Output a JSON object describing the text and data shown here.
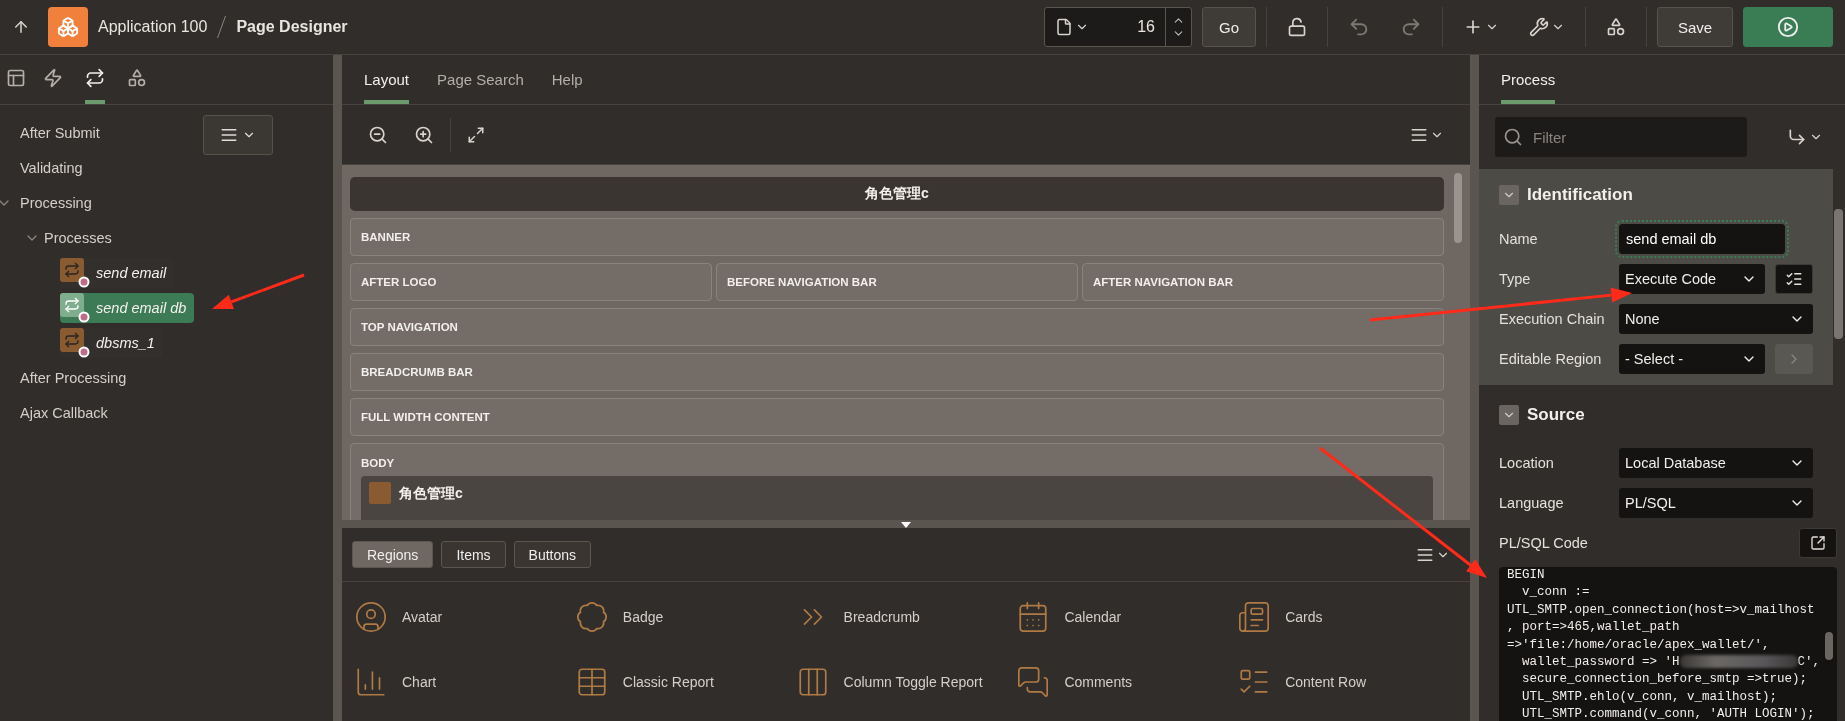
{
  "header": {
    "app": "Application 100",
    "page": "Page Designer"
  },
  "toolbar": {
    "page_number": "16",
    "go": "Go",
    "save": "Save"
  },
  "left_tabs": [
    {
      "kind": "rendering",
      "selected": false
    },
    {
      "kind": "dynamic-actions",
      "selected": false
    },
    {
      "kind": "processing",
      "selected": true
    },
    {
      "kind": "shared",
      "selected": false
    }
  ],
  "tree": [
    {
      "label": "After Submit"
    },
    {
      "label": "Validating"
    },
    {
      "label": "Processing",
      "expanded": true,
      "children": [
        {
          "label": "Processes",
          "expanded": true,
          "children": [
            {
              "label": "send email",
              "kind": "process",
              "selected": false
            },
            {
              "label": "send email db",
              "kind": "process",
              "selected": true
            },
            {
              "label": "dbsms_1",
              "kind": "process",
              "selected": false
            }
          ]
        }
      ]
    },
    {
      "label": "After Processing"
    },
    {
      "label": "Ajax Callback"
    }
  ],
  "center_tabs": [
    {
      "label": "Layout",
      "selected": true
    },
    {
      "label": "Page Search",
      "selected": false
    },
    {
      "label": "Help",
      "selected": false
    }
  ],
  "layout": {
    "page_title": "角色管理c",
    "rows": [
      [
        "BANNER"
      ],
      [
        "AFTER LOGO",
        "BEFORE NAVIGATION BAR",
        "AFTER NAVIGATION BAR"
      ],
      [
        "TOP NAVIGATION"
      ],
      [
        "BREADCRUMB BAR"
      ],
      [
        "FULL WIDTH CONTENT"
      ]
    ],
    "body": {
      "label": "BODY",
      "region": "角色管理c"
    }
  },
  "gallery": {
    "tabs": [
      {
        "label": "Regions",
        "selected": true
      },
      {
        "label": "Items",
        "selected": false
      },
      {
        "label": "Buttons",
        "selected": false
      }
    ],
    "items": [
      {
        "label": "Avatar",
        "kind": "avatar"
      },
      {
        "label": "Badge",
        "kind": "badge"
      },
      {
        "label": "Breadcrumb",
        "kind": "breadcrumb"
      },
      {
        "label": "Calendar",
        "kind": "calendar"
      },
      {
        "label": "Cards",
        "kind": "cards"
      },
      {
        "label": "Chart",
        "kind": "chart"
      },
      {
        "label": "Classic Report",
        "kind": "classic-report"
      },
      {
        "label": "Column Toggle Report",
        "kind": "column-toggle"
      },
      {
        "label": "Comments",
        "kind": "comments"
      },
      {
        "label": "Content Row",
        "kind": "content-row"
      }
    ]
  },
  "property_tabs": [
    {
      "label": "Process",
      "selected": true
    }
  ],
  "filter": {
    "placeholder": "Filter"
  },
  "sections": [
    {
      "title": "Identification",
      "expanded": true,
      "fields": [
        {
          "label": "Name",
          "kind": "text",
          "value": "send email db",
          "focused": true
        },
        {
          "label": "Type",
          "kind": "select",
          "value": "Execute Code",
          "list_button": true
        },
        {
          "label": "Execution Chain",
          "kind": "select",
          "value": "None"
        },
        {
          "label": "Editable Region",
          "kind": "select",
          "value": "- Select -",
          "next_button": {
            "disabled": true
          }
        }
      ]
    },
    {
      "title": "Source",
      "expanded": true,
      "fields": [
        {
          "label": "Location",
          "kind": "select",
          "value": "Local Database"
        },
        {
          "label": "Language",
          "kind": "select",
          "value": "PL/SQL"
        },
        {
          "label": "PL/SQL Code",
          "kind": "code",
          "expand_button": true,
          "lines": [
            {
              "kind": "plain",
              "text": "BEGIN"
            },
            {
              "kind": "plain",
              "text": "  v_conn :="
            },
            {
              "kind": "plain",
              "text": "UTL_SMTP.open_connection(host=>v_mailhost"
            },
            {
              "kind": "plain",
              "text": ", port=>465,wallet_path"
            },
            {
              "kind": "plain",
              "text": "=>'file:/home/oracle/apex_wallet/',"
            },
            {
              "kind": "redacted",
              "before": "  wallet_password => 'H",
              "after": "C',"
            },
            {
              "kind": "plain",
              "text": "  secure_connection_before_smtp =>true);"
            },
            {
              "kind": "plain",
              "text": "  UTL_SMTP.ehlo(v_conn, v_mailhost);"
            },
            {
              "kind": "plain",
              "text": "  UTL_SMTP.command(v_conn, 'AUTH LOGIN');"
            }
          ]
        }
      ]
    }
  ]
}
